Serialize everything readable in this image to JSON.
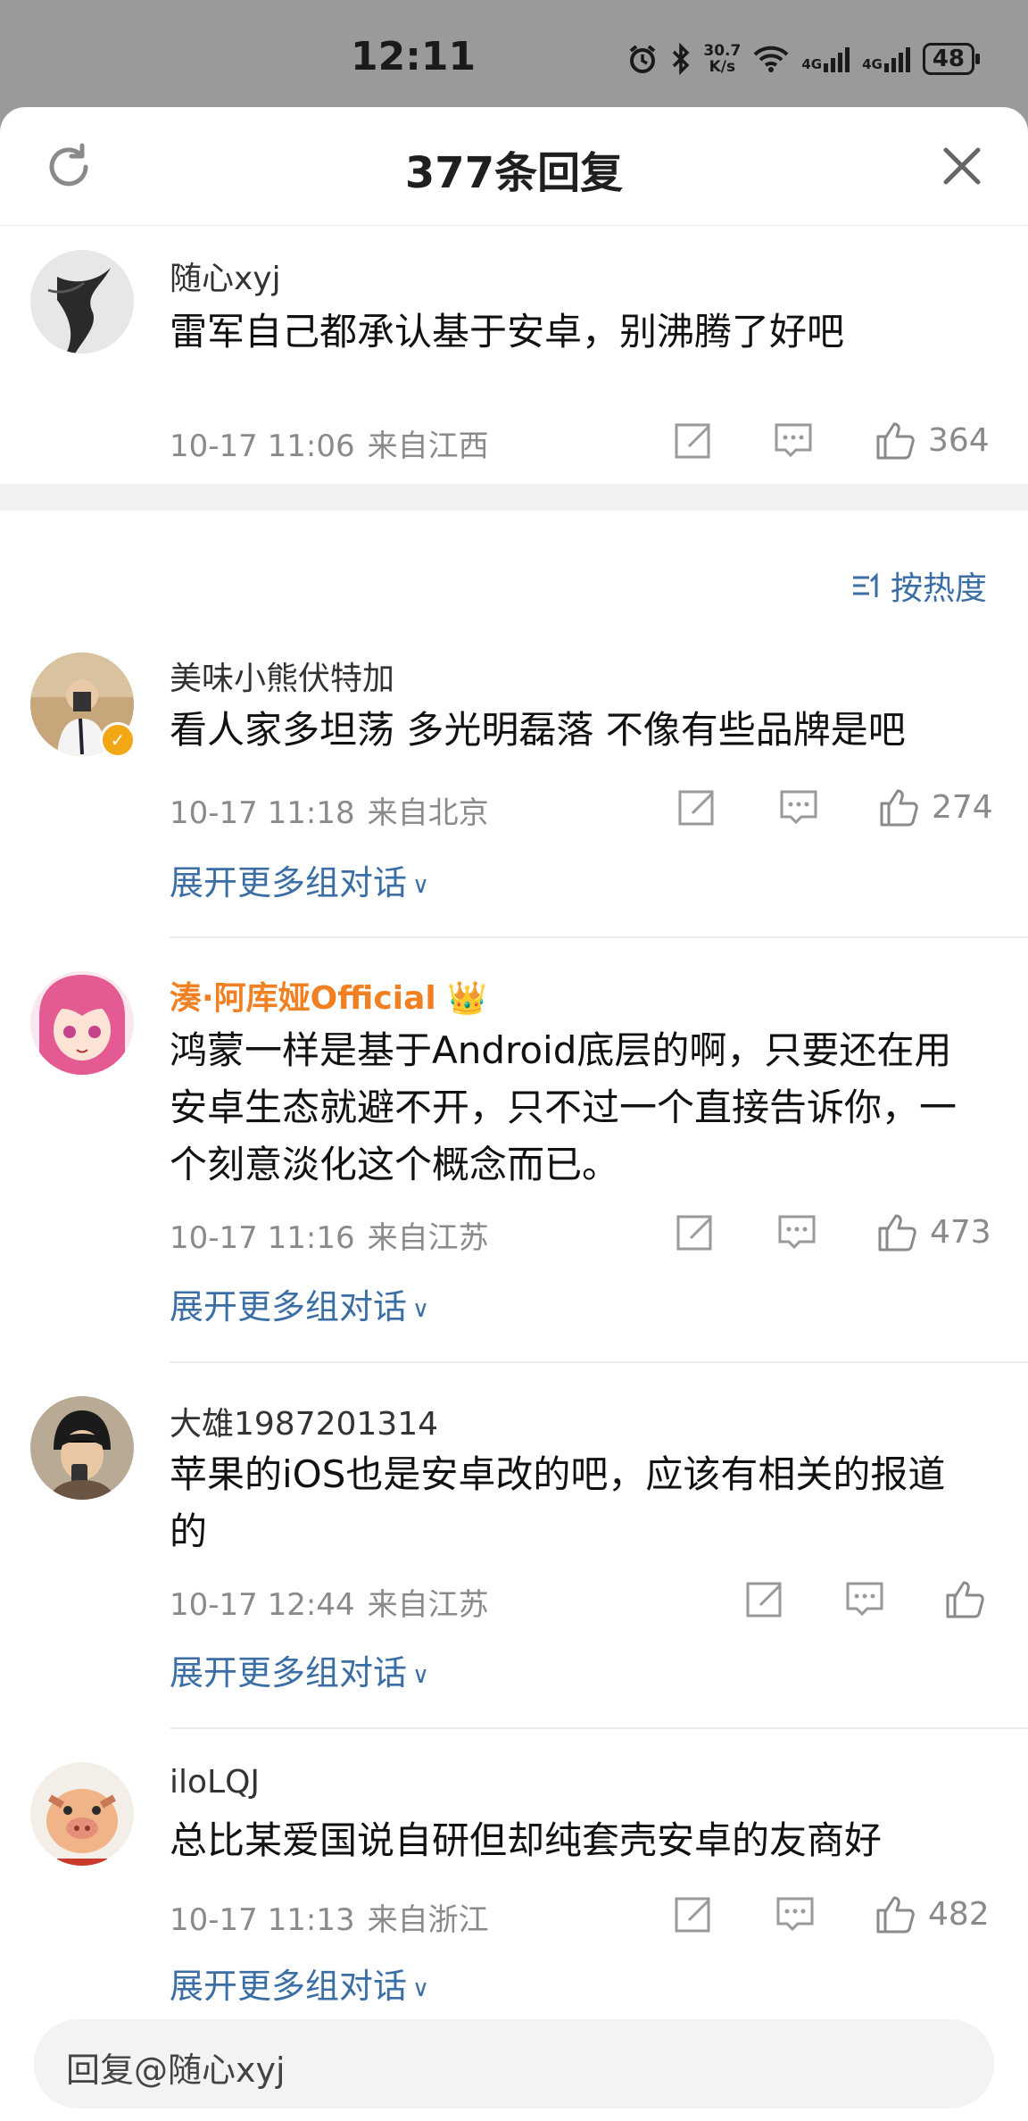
{
  "status_bar": {
    "time": "12:11",
    "net_speed_value": "30.7",
    "net_speed_unit": "K/s",
    "signal_a_label": "4G",
    "signal_b_label": "4G",
    "battery": "48"
  },
  "header": {
    "title": "377条回复",
    "refresh_icon": "refresh-icon",
    "close_icon": "close-icon"
  },
  "sort_label": "按热度",
  "comments": [
    {
      "user": "随心xyj",
      "text": "雷军自己都承认基于安卓，别沸腾了好吧",
      "time": "10-17 11:06",
      "location": "来自江西",
      "likes": "364"
    },
    {
      "user": "美味小熊伏特加",
      "text": "看人家多坦荡 多光明磊落 不像有些品牌是吧",
      "time": "10-17 11:18",
      "location": "来自北京",
      "likes": "274",
      "expand": "展开更多组对话"
    },
    {
      "user": "湊·阿库娅Official",
      "text": "鸿蒙一样是基于Android底层的啊，只要还在用安卓生态就避不开，只不过一个直接告诉你，一个刻意淡化这个概念而已。",
      "time": "10-17 11:16",
      "location": "来自江苏",
      "likes": "473",
      "expand": "展开更多组对话"
    },
    {
      "user": "大雄1987201314",
      "text": "苹果的iOS也是安卓改的吧，应该有相关的报道的",
      "time": "10-17 12:44",
      "location": "来自江苏",
      "likes": "",
      "expand": "展开更多组对话"
    },
    {
      "user": "iloLQJ",
      "text": "总比某爱国说自研但却纯套壳安卓的友商好",
      "time": "10-17 11:13",
      "location": "来自浙江",
      "likes": "482",
      "expand": "展开更多组对话"
    }
  ],
  "reply_bar": {
    "placeholder": "回复@随心xyj"
  },
  "colors": {
    "link": "#3a6ea5",
    "vip_name": "#f08022",
    "verified_badge": "#f2a716"
  }
}
